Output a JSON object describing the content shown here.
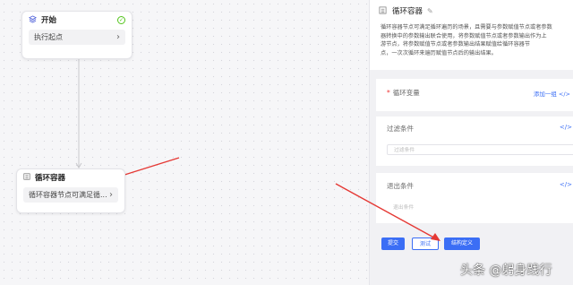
{
  "canvas": {
    "start_node": {
      "title": "开始",
      "subtitle": "执行起点",
      "status_icon": "check-circle-icon"
    },
    "loop_node": {
      "title": "循环容器",
      "subtitle": "循环容器节点可满足循..."
    }
  },
  "panel": {
    "title": "循环容器",
    "description_lines": [
      "循环容器节点可满足循环遍历的场景，且需要与参数赋值节点或者参数",
      "器转换中的参数输出联合使用，将参数赋值节点或者参数输出作为上",
      "游节点，将参数赋值节点或者参数输出结果赋值给循环容器节",
      "点，一次次循环来遍历赋值节点后的输出结果。"
    ],
    "loop_vars": {
      "label": "循环变量",
      "required": "*",
      "add_label": "添加一组",
      "code_icon": "</>"
    },
    "filter": {
      "label": "过滤条件",
      "placeholder": "过滤条件",
      "code_icon": "</>"
    },
    "exit": {
      "label": "退出条件",
      "placeholder": "退出条件",
      "code_icon": "</>"
    },
    "buttons": {
      "submit": "提交",
      "test": "测试",
      "structure": "结构定义"
    }
  },
  "watermark": "头条 @躬身践行",
  "colors": {
    "accent": "#3b6ef5",
    "annotation_arrow": "#e53935",
    "success": "#52c41a"
  }
}
